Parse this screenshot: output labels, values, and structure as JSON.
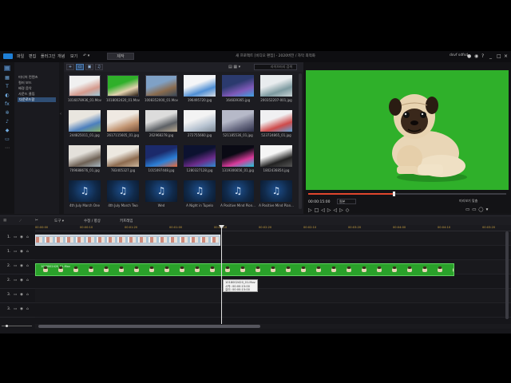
{
  "titlebar": {
    "menus": [
      "파일",
      "편집",
      "플러그인",
      "개념",
      "보기"
    ],
    "produce_label": "제작",
    "document_title": "새 프로젝트 [비디오 편집] - 2020버전 / 자막 최적화",
    "account": "dsvf sdfsd",
    "window_controls": [
      "_",
      "□",
      "×"
    ]
  },
  "rail": {
    "icons": [
      "media-icon",
      "transition-icon",
      "title-icon",
      "fx-icon",
      "pip-icon",
      "particle-icon",
      "audio-icon",
      "chapter-icon",
      "subtitle-icon",
      "more-icon"
    ]
  },
  "tree": {
    "items": [
      "미디어 컨텐츠",
      "컬러 보드",
      "배경 음악",
      "사운드 클립",
      "다운로드함"
    ],
    "selected_index": 4
  },
  "media": {
    "search_placeholder": "라이브러리 검색",
    "import_icon": "+",
    "items": [
      {
        "label": "1016078936_01.Mov",
        "kind": "video",
        "palette": [
          "#f0f0f0",
          "#d59a8d",
          "#9cc7d6"
        ]
      },
      {
        "label": "1018002420_01.Mov",
        "kind": "video",
        "palette": [
          "#2fb02a",
          "#e4d2b0",
          "#2a1d12"
        ]
      },
      {
        "label": "1008352000_01.Mov",
        "kind": "video",
        "palette": [
          "#7fa1c6",
          "#8a6b4d",
          "#3b4a58"
        ]
      },
      {
        "label": "196495720.jpg",
        "kind": "image",
        "palette": [
          "#f4f5f7",
          "#4f8fd5",
          "#d9dde2"
        ]
      },
      {
        "label": "164839365.jpg",
        "kind": "image",
        "palette": [
          "#2b3a6e",
          "#7e59b8",
          "#3fa2e0"
        ]
      },
      {
        "label": "200352207-001.jpg",
        "kind": "image",
        "palette": [
          "#e8ecee",
          "#7d9aa0",
          "#c8d2d4"
        ]
      },
      {
        "label": "244825011_01.jpg",
        "kind": "image",
        "palette": [
          "#e9e6df",
          "#4c7fbe",
          "#86b067"
        ]
      },
      {
        "label": "2617115605_01.jpg",
        "kind": "image",
        "palette": [
          "#efe9e2",
          "#c19471",
          "#6f4a33"
        ]
      },
      {
        "label": "262968278.jpg",
        "kind": "image",
        "palette": [
          "#dcdcdc",
          "#5d6166",
          "#b8a88f"
        ]
      },
      {
        "label": "272755660.jpg",
        "kind": "image",
        "palette": [
          "#f3f3f3",
          "#b7c3d1",
          "#7c8894"
        ]
      },
      {
        "label": "521185536_01.jpg",
        "kind": "image",
        "palette": [
          "#b6b9c8",
          "#6b6d84",
          "#2d2f48"
        ]
      },
      {
        "label": "523724865_01.jpg",
        "kind": "image",
        "palette": [
          "#f0f0f2",
          "#cf4b4b",
          "#5fa4d8"
        ]
      },
      {
        "label": "709688676_01.jpg",
        "kind": "image",
        "palette": [
          "#e3e0da",
          "#6e6155",
          "#a5b5c0"
        ]
      },
      {
        "label": "783405327.jpg",
        "kind": "image",
        "palette": [
          "#ece8e0",
          "#8d6b4f",
          "#c9b49b"
        ]
      },
      {
        "label": "1015097448.jpg",
        "kind": "image",
        "palette": [
          "#1b2a6b",
          "#2c7fd6",
          "#e86a3a"
        ]
      },
      {
        "label": "1280327128.jpg",
        "kind": "image",
        "palette": [
          "#0c1230",
          "#6b2c8a",
          "#2d8cd1"
        ]
      },
      {
        "label": "1319306656_01.jpg",
        "kind": "image",
        "palette": [
          "#0a0a14",
          "#d83a9a",
          "#1fc6d8"
        ]
      },
      {
        "label": "1802436854.jpg",
        "kind": "image",
        "palette": [
          "#f5f5f5",
          "#222222",
          "#555555"
        ]
      },
      {
        "label": "4th July March One",
        "kind": "music"
      },
      {
        "label": "4th July March Two",
        "kind": "music"
      },
      {
        "label": "Wed",
        "kind": "music"
      },
      {
        "label": "A Night in Tupelo",
        "kind": "music"
      },
      {
        "label": "A Positive Mind Pion...",
        "kind": "music"
      },
      {
        "label": "A Positive Mind Pian...",
        "kind": "music"
      }
    ]
  },
  "preview": {
    "timecode": "00:00:15:00",
    "quality": "원본",
    "zoom_label": "미리보기 맞춤",
    "progress": 0.43,
    "controls": [
      "▷",
      "□",
      "◁",
      "▷",
      "◁",
      "▷",
      "◇"
    ],
    "tools": [
      "▭",
      "▭",
      "◯",
      "▾"
    ]
  },
  "timeline": {
    "tools": [
      "✂",
      "도구 ▾",
      "수정 / 향상",
      "키프레임"
    ],
    "ticks": [
      "00:00:00",
      "00:00:10",
      "00:01:20",
      "00:01:00",
      "00:02:10",
      "00:02:20",
      "00:02:10",
      "00:03:20",
      "00:04:00",
      "00:04:10",
      "00:03:20"
    ],
    "tracks": [
      "1.",
      "1.",
      "2.",
      "2.",
      "3.",
      "3."
    ],
    "video_clip_label": "1018002420_01.Mov",
    "tooltip": {
      "name": "1018002420_01.Mov",
      "start": "시작: 00:00:15:00",
      "duration": "길이: 00:00:15:00"
    }
  }
}
